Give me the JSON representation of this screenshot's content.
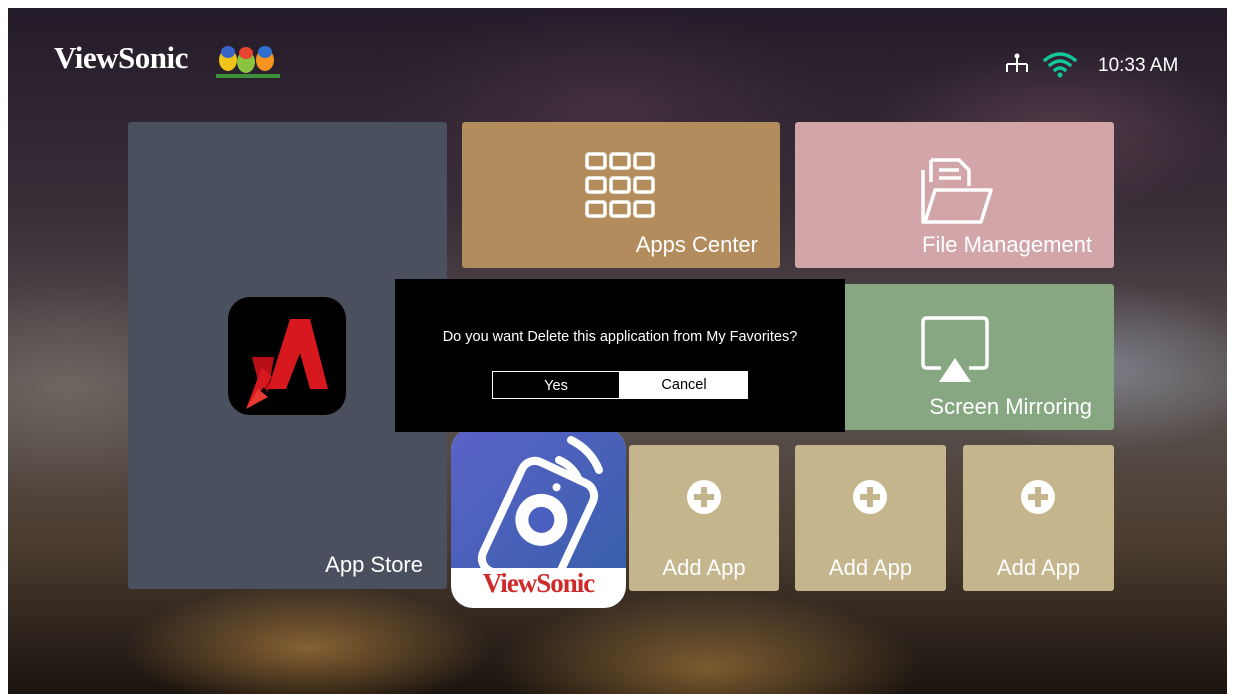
{
  "header": {
    "brand": "ViewSonic",
    "clock": "10:33 AM",
    "icons": [
      "ethernet-icon",
      "wifi-icon"
    ]
  },
  "tiles": {
    "app_store": {
      "label": "App Store",
      "color": "#4a505e"
    },
    "apps_center": {
      "label": "Apps Center",
      "color": "#b28c5c"
    },
    "file_management": {
      "label": "File Management",
      "color": "#d2a6a8"
    },
    "screen_mirroring": {
      "label": "Screen Mirroring",
      "color": "#86a782"
    },
    "viewsonic_remote": {
      "brand": "ViewSonic"
    },
    "add_apps": [
      {
        "label": "Add App"
      },
      {
        "label": "Add App"
      },
      {
        "label": "Add App"
      }
    ]
  },
  "dialog": {
    "message": "Do you want Delete this application from My Favorites?",
    "yes_label": "Yes",
    "cancel_label": "Cancel"
  }
}
